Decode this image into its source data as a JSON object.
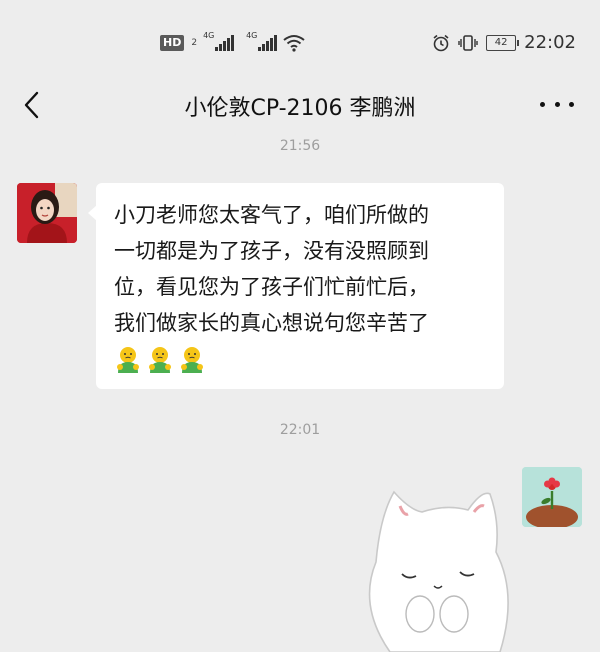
{
  "status_bar": {
    "hd_label": "HD",
    "hd_sub": "2",
    "signal1_label": "4G",
    "signal2_label": "4G",
    "battery_level": "42",
    "time": "22:02",
    "icons": [
      "hd-volte-icon",
      "signal-4g-icon",
      "signal-4g-icon",
      "wifi-icon",
      "alarm-icon",
      "vibrate-icon",
      "battery-icon"
    ]
  },
  "header": {
    "title": "小伦敦CP-2106 李鹏洲",
    "back_icon": "chevron-left-icon",
    "more_icon": "more-dots-icon"
  },
  "messages": [
    {
      "timestamp": "21:56",
      "sender": "other",
      "text": "小刀老师您太客气了，咱们所做的\n一切都是为了孩子，没有没照顾到\n位，看见您为了孩子们忙前忙后，\n我们做家长的真心想说句您辛苦了",
      "emojis": [
        "🙇",
        "🙇",
        "🙇"
      ]
    },
    {
      "timestamp": "22:01",
      "sender": "self",
      "type": "sticker",
      "sticker": "white-cat-sticker"
    }
  ],
  "colors": {
    "background": "#ededed",
    "bubble_incoming": "#ffffff",
    "timestamp": "#9e9e9e"
  }
}
